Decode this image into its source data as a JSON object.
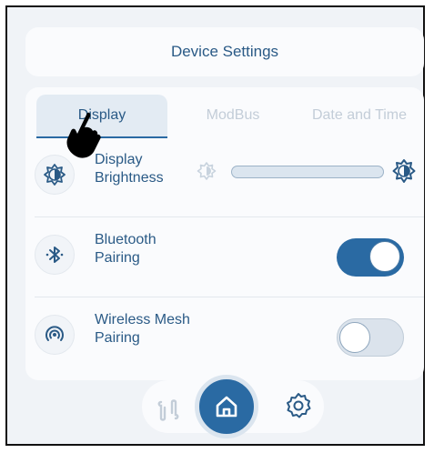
{
  "header": {
    "title": "Device Settings"
  },
  "tabs": [
    {
      "label": "Display",
      "active": true
    },
    {
      "label": "ModBus",
      "active": false
    },
    {
      "label": "Date and Time",
      "active": false
    }
  ],
  "rows": [
    {
      "label": "Display Brightness",
      "icon": "brightness-icon",
      "control": "slider"
    },
    {
      "label": "Bluetooth Pairing",
      "icon": "bluetooth-icon",
      "control": "toggle",
      "state": "on"
    },
    {
      "label": "Wireless Mesh Pairing",
      "icon": "wireless-mesh-icon",
      "control": "toggle",
      "state": "off"
    }
  ],
  "bottom_nav": [
    {
      "icon": "swap-icon"
    },
    {
      "icon": "home-icon",
      "active": true
    },
    {
      "icon": "gear-icon"
    }
  ],
  "colors": {
    "accent": "#2a6aa3",
    "text": "#2a5a86",
    "inactive_text": "#c3cdd8",
    "background": "#f0f3f7"
  }
}
